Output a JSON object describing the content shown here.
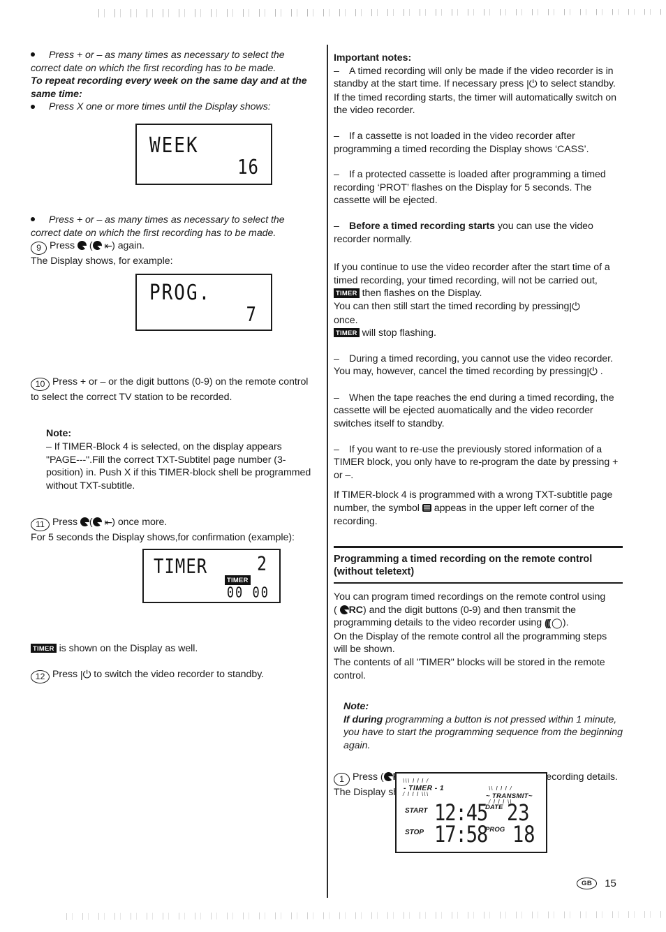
{
  "page": {
    "number": "15",
    "region_code": "GB"
  },
  "left_column": {
    "bullet1": {
      "line1": "Press + or – as many times as necessary to select the",
      "line2": "correct date on which the first recording has to be made."
    },
    "bold_heading": "To repeat recording every week on the same day and at the same time:",
    "bullet2": "Press X one or more times until the Display shows:",
    "display_week": {
      "label": "WEEK",
      "value": "16"
    },
    "bullet3": {
      "line1": "Press + or – as many times as necessary to select the",
      "line2": "correct date on which the first recording has to be made."
    },
    "step9": {
      "number": "9",
      "text_before": "Press",
      "text_after": ") again.",
      "line2": "The Display shows, for example:"
    },
    "display_prog": {
      "label": "PROG.",
      "value": "7"
    },
    "step10": {
      "number": "10",
      "text": "Press + or – or the digit buttons (0-9) on the remote control to select the correct TV station to be recorded."
    },
    "note": {
      "title": "Note:",
      "body": "–  If  TIMER-Block 4 is selected, on the display appears \"PAGE---\".Fill the correct TXT-Subtitel page number (3-position) in. Push X if this TIMER-block shell be programmed without TXT-subtitle."
    },
    "step11": {
      "number": "11",
      "text_before": "Press",
      "text_after": ") once more.",
      "line2": "For 5 seconds the Display shows,for confirmation  (example):"
    },
    "display_timer": {
      "label": "TIMER",
      "value": "2",
      "badge": "TIMER",
      "zeros": "00 00"
    },
    "timer_note": {
      "badge": "TIMER",
      "text": "is shown on the Display as well."
    },
    "step12": {
      "number": "12",
      "text_before": "Press",
      "text_after": "to switch the video recorder to standby."
    }
  },
  "right_column": {
    "important_notes_title": "Important notes:",
    "note_a": {
      "dash": "–",
      "part1": "A timed recording will only be made if the video recorder is in standby at the start time. If necessary press",
      "part2": "to select standby.",
      "part3": "If the timed recording starts, the timer will automatically switch on the video recorder."
    },
    "note_b": {
      "dash": "–",
      "text": "If a cassette is not loaded in the video recorder after programming a timed recording the Display shows ‘CASS’."
    },
    "note_c": {
      "dash": "–",
      "text": "If a protected cassette is loaded after programming a timed recording ‘PROT’ flashes on the Display for 5 seconds. The cassette will be ejected."
    },
    "note_d": {
      "dash": "–",
      "bold": "Before a timed recording starts",
      "text": "you can use the video recorder normally."
    },
    "para_continue": {
      "part1": "If you continue to use the video recorder after the start time of a timed recording, your timed recording, will not be carried out,",
      "badge": "TIMER",
      "part2": "then flashes on the Display.",
      "part3": "You can then still start the timed recording by pressing",
      "part4": "once.",
      "badge2": "TIMER",
      "part5": "will stop flashing."
    },
    "note_e": {
      "dash": "–",
      "part1": "During a timed recording, you cannot use the video recorder. You may, however, cancel the timed recording by pressing",
      "part2": "."
    },
    "note_f": {
      "dash": "–",
      "text": "When the tape reaches the end during a timed recording, the cassette will be ejected auomatically and the video recorder switches itself to standby."
    },
    "note_g": {
      "dash": "–",
      "text": "If you want to re-use the previously stored information of a TIMER block, you only have to re-program the date by pressing + or –."
    },
    "note_h": {
      "part1": "If TIMER-block 4 is programmed with a wrong TXT-subtitle page number, the symbol",
      "part2": "appeas in the upper left corner of the recording."
    },
    "section": {
      "heading_line1": "Programming a timed recording on the remote control",
      "heading_line2": "(without teletext)"
    },
    "section_body": {
      "part1": "You can program timed recordings on the remote control using",
      "part2": "(",
      "rc_label": "RC",
      "part3": ") and the digit buttons (0-9) and then transmit the programming details to the video recorder using",
      "part4": ").",
      "part5": "On the Display of the remote control all the programming steps will be shown.",
      "part6": "The contents of all \"TIMER\" blocks will be stored in the remote control."
    },
    "note_rc": {
      "title": "Note:",
      "bold_word": "If during",
      "text": "programming a  button is not pressed within 1 minute, you have to start the programming sequence from the beginning again."
    },
    "step1": {
      "number": "1",
      "text_before": "Press (",
      "rc_label": "RC",
      "text_after": ") to recall the last programmed recording details.",
      "line2": "The Display shows for example:"
    },
    "display_remote": {
      "timer_label": "TIMER - 1",
      "transmit_label": "TRANSMIT",
      "start_label": "START",
      "stop_label": "STOP",
      "start_time": "12:45",
      "stop_time": "17:58",
      "date_label": "DATE",
      "prog_label": "PROG",
      "date_value": "23",
      "prog_value": "18"
    }
  }
}
